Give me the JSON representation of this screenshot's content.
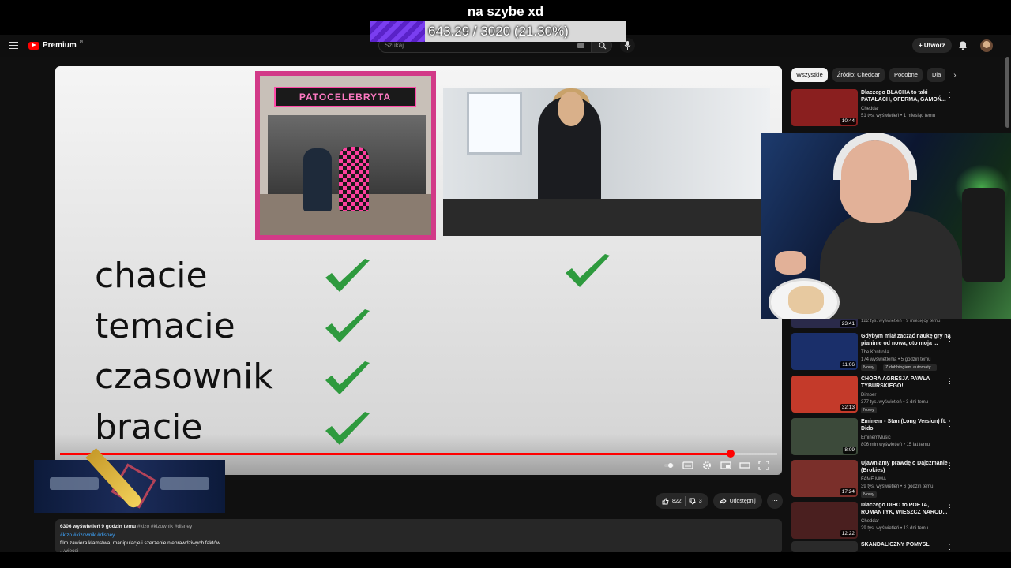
{
  "overlay": {
    "title": "na szybe xd",
    "goal_text": "643.29 / 3020 (21.30%)",
    "goal_fraction": 0.213
  },
  "header": {
    "logo_text": "Premium",
    "logo_region": "PL",
    "search_placeholder": "Szukaj",
    "create_label": "Utwórz"
  },
  "video": {
    "album_sign": "PATOCELEBRYTA",
    "words": [
      "chacie",
      "temacie",
      "czasownik",
      "bracie"
    ],
    "progress_fraction": 0.935
  },
  "actions": {
    "likes": "822",
    "dislikes": "3",
    "share": "Udostępnij"
  },
  "description": {
    "stats": "6306 wyświetleń  9 godzin temu",
    "inline_tags": "#kizo #kizownik #disney",
    "tags": "#kizo #kizownik #disney",
    "text": "film zawiera kłamstwa, manipulacje i szerzenie nieprawdziwych faktów",
    "more": "...więcej"
  },
  "sidebar": {
    "chips": [
      "Wszystkie",
      "Źródło: Cheddar",
      "Podobne",
      "Dla"
    ],
    "recs": [
      {
        "title": "Dlaczego BLACHA to taki PATAŁACH, OFERMA, GAMOŃ...",
        "channel": "Cheddar",
        "meta": "51 tys. wyświetleń • 1 miesiąc temu",
        "duration": "10:44",
        "color": "#8a1f1f"
      },
      {
        "title": "Gdybym miał zacząć naukę gry na pianinie od nowa, oto moja ...",
        "channel": "The Kontrolla",
        "meta": "174 wyświetlenia • 5 godzin temu",
        "duration": "11:06",
        "badge": "Nowy",
        "badge2": "Z dubbingiem automaty...",
        "color": "#1a2f6a"
      },
      {
        "title": "CHORA AGRESJA PAWŁA TYBURSKIEGO!",
        "channel": "Dimper",
        "meta": "377 tys. wyświetleń • 3 dni temu",
        "duration": "32:13",
        "badge": "Nowy",
        "color": "#c43a2a"
      },
      {
        "title": "Eminem - Stan (Long Version) ft. Dido",
        "channel": "EminemMusic",
        "meta": "806 mln wyświetleń • 15 lat temu",
        "duration": "8:09",
        "color": "#3c4a3a"
      },
      {
        "title": "Ujawniamy prawdę o Dajczmanie (Brokies)",
        "channel": "FAME MMA",
        "meta": "39 tys. wyświetleń • 6 godzin temu",
        "duration": "17:24",
        "badge": "Nowy",
        "color": "#7a2f2a"
      },
      {
        "title": "Dlaczego DIHO to POETA, ROMANTYK, WIESZCZ NAROD...",
        "channel": "Cheddar",
        "meta": "29 tys. wyświetleń • 13 dni temu",
        "duration": "12:22",
        "color": "#4a1f1f"
      },
      {
        "title": "SKANDALICZNY POMYSŁ",
        "channel": "",
        "meta": "",
        "duration": "",
        "color": "#2a2a2a"
      }
    ],
    "hidden_strip": {
      "duration": "23:41",
      "meta": "122 tys. wyświetleń • 9 miesięcy temu"
    }
  }
}
